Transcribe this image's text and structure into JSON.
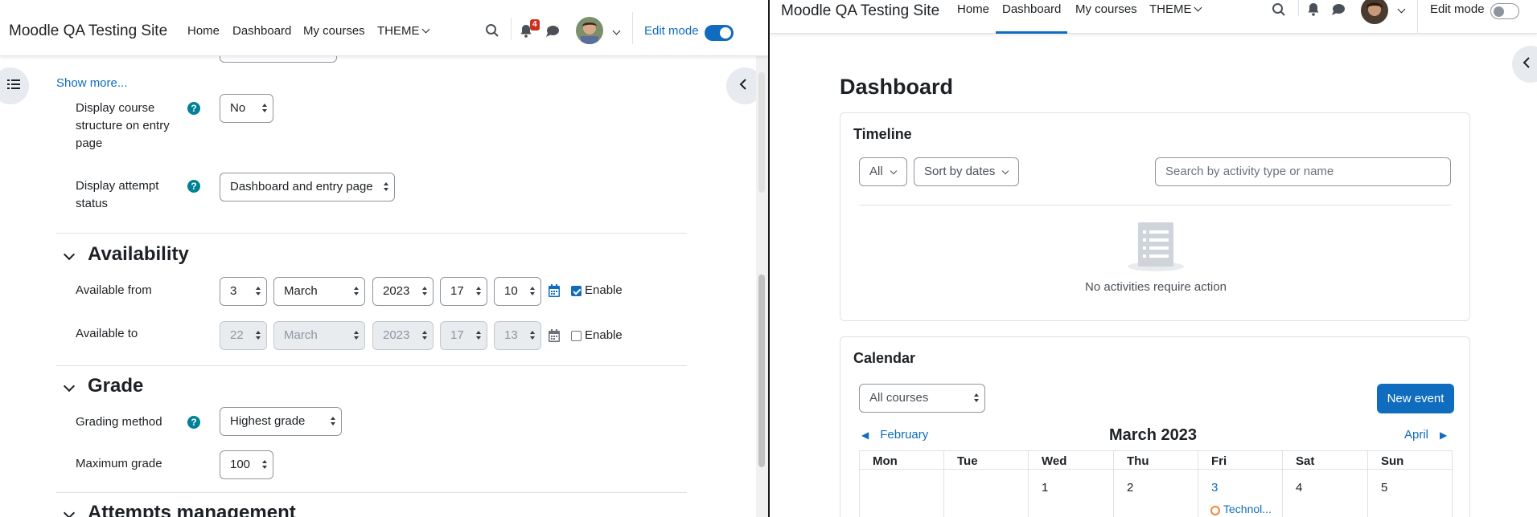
{
  "left": {
    "navbar": {
      "site_name": "Moodle QA Testing Site",
      "links": [
        "Home",
        "Dashboard",
        "My courses",
        "THEME"
      ],
      "notification_count": "4",
      "edit_mode_label": "Edit mode",
      "edit_mode_on": true
    },
    "form": {
      "show_more": "Show more...",
      "display_course_structure": {
        "label": "Display course structure on entry page",
        "value": "No"
      },
      "display_attempt_status": {
        "label": "Display attempt status",
        "value": "Dashboard and entry page"
      },
      "availability": {
        "title": "Availability",
        "available_from": {
          "label": "Available from",
          "day": "3",
          "month": "March",
          "year": "2023",
          "hour": "17",
          "minute": "10",
          "enable_label": "Enable",
          "enabled": true
        },
        "available_to": {
          "label": "Available to",
          "day": "22",
          "month": "March",
          "year": "2023",
          "hour": "17",
          "minute": "13",
          "enable_label": "Enable",
          "enabled": false
        }
      },
      "grade": {
        "title": "Grade",
        "grading_method": {
          "label": "Grading method",
          "value": "Highest grade"
        },
        "maximum_grade": {
          "label": "Maximum grade",
          "value": "100"
        }
      },
      "attempts_management": {
        "title": "Attempts management"
      }
    }
  },
  "right": {
    "navbar": {
      "site_name": "Moodle QA Testing Site",
      "links": [
        "Home",
        "Dashboard",
        "My courses",
        "THEME"
      ],
      "active_link": "Dashboard",
      "edit_mode_label": "Edit mode",
      "edit_mode_on": false
    },
    "page_title": "Dashboard",
    "timeline": {
      "title": "Timeline",
      "filter": "All",
      "sort": "Sort by dates",
      "search_placeholder": "Search by activity type or name",
      "empty_message": "No activities require action"
    },
    "calendar": {
      "title": "Calendar",
      "course_filter": "All courses",
      "new_event": "New event",
      "prev_month": "February",
      "current_month": "March 2023",
      "next_month": "April",
      "weekdays": [
        "Mon",
        "Tue",
        "Wed",
        "Thu",
        "Fri",
        "Sat",
        "Sun"
      ],
      "first_row_days": [
        "",
        "",
        "1",
        "2",
        "3",
        "4",
        "5"
      ],
      "event": {
        "day": "3",
        "label": "Technol..."
      }
    }
  },
  "colors": {
    "accent": "#0f6cbf",
    "help": "#008196",
    "badge": "#ca3120"
  }
}
